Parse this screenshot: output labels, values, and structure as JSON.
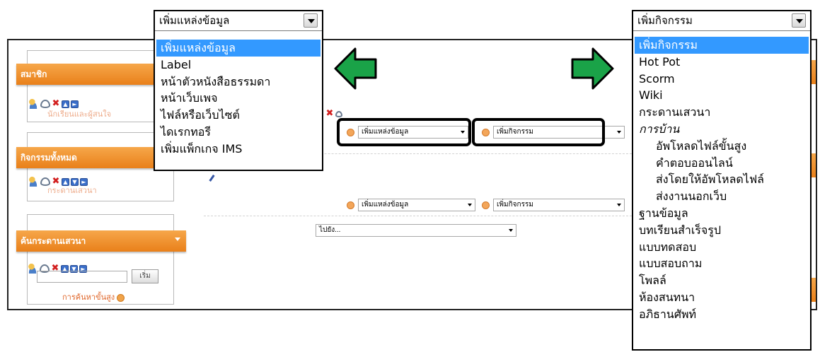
{
  "left_blocks": [
    {
      "title": "สมาชิก",
      "link": "นักเรียนและผู้สนใจ"
    },
    {
      "title": "กิจกรรมทั้งหมด",
      "link": "กระดานเสวนา"
    },
    {
      "title": "ค้นกระดานเสวนา",
      "search_button": "เริ่ม",
      "advanced_search": "การค้นหาขั้นสูง"
    }
  ],
  "section_top": {
    "resource_select": "เพิ่มแหล่งข้อมูล",
    "activity_select": "เพิ่มกิจกรรม"
  },
  "section_bottom": {
    "resource_select": "เพิ่มแหล่งข้อมูล",
    "activity_select": "เพิ่มกิจกรรม"
  },
  "jump_select": "ไปยัง...",
  "resource_dropdown": {
    "current": "เพิ่มแหล่งข้อมูล",
    "options": [
      {
        "label": "เพิ่มแหล่งข้อมูล",
        "selected": true
      },
      {
        "label": "Label"
      },
      {
        "label": "หน้าตัวหนังสือธรรมดา"
      },
      {
        "label": "หน้าเว็บเพจ"
      },
      {
        "label": "ไฟล์หรือเว็บไซต์"
      },
      {
        "label": "ไดเรกทอรี"
      },
      {
        "label": "เพิ่มแพ็กเกจ IMS"
      }
    ]
  },
  "activity_dropdown": {
    "current": "เพิ่มกิจกรรม",
    "options": [
      {
        "label": "เพิ่มกิจกรรม",
        "selected": true
      },
      {
        "label": "Hot Pot"
      },
      {
        "label": "Scorm"
      },
      {
        "label": "Wiki"
      },
      {
        "label": "กระดานเสวนา"
      },
      {
        "label": "การบ้าน",
        "group": true
      },
      {
        "label": "อัพโหลดไฟล์ขั้นสูง",
        "sub": true
      },
      {
        "label": "คำตอบออนไลน์",
        "sub": true
      },
      {
        "label": "ส่งโดยให้อัพโหลดไฟล์",
        "sub": true
      },
      {
        "label": "ส่งงานนอกเว็บ",
        "sub": true
      },
      {
        "label": "ฐานข้อมูล"
      },
      {
        "label": "บทเรียนสำเร็จรูป"
      },
      {
        "label": "แบบทดสอบ"
      },
      {
        "label": "แบบสอบถาม"
      },
      {
        "label": "โพลล์"
      },
      {
        "label": "ห้องสนทนา"
      },
      {
        "label": "อภิธานศัพท์"
      }
    ]
  },
  "colors": {
    "block_header": "#e9801a",
    "link": "#e0672b",
    "selection": "#3399ff",
    "arrow_green": "#1aa348"
  }
}
